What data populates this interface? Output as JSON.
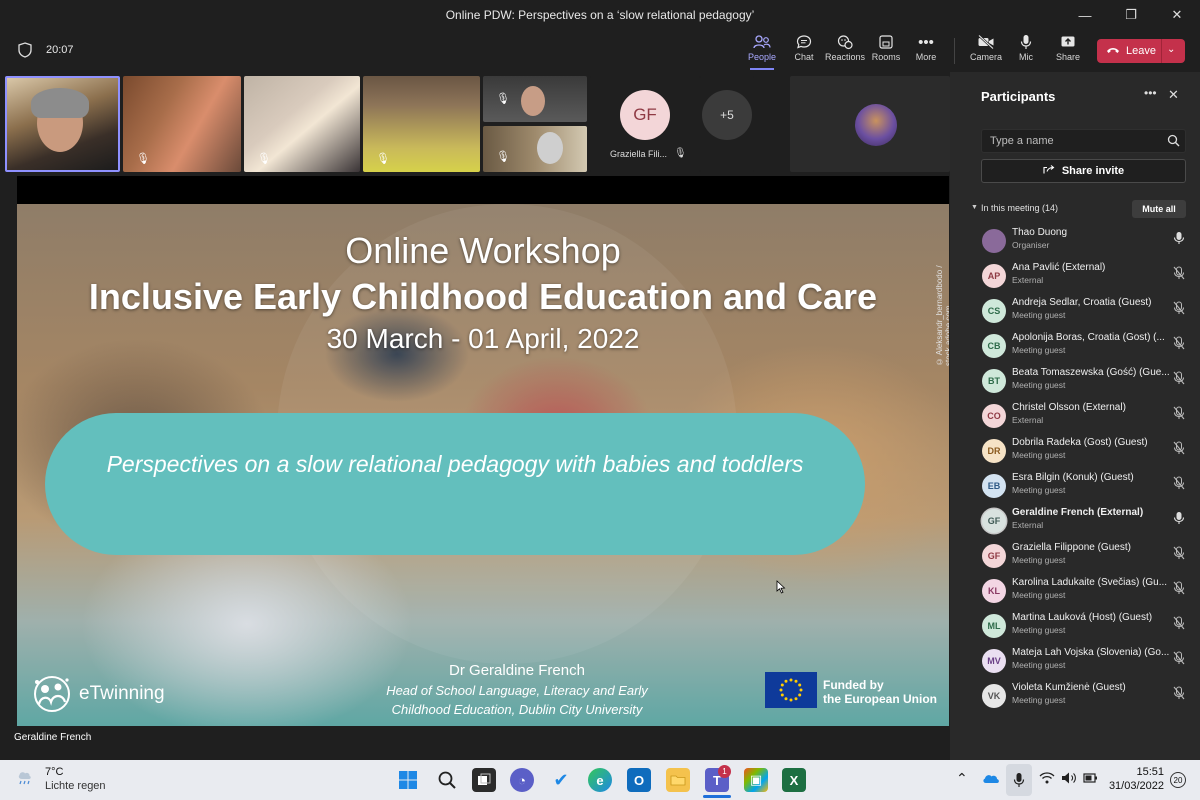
{
  "window": {
    "title": "Online PDW: Perspectives on a ‘slow relational pedagogy’",
    "minimize_icon": "—",
    "restore_icon": "❐",
    "close_icon": "✕"
  },
  "meeting": {
    "timer": "20:07",
    "toolbar": {
      "people": "People",
      "chat": "Chat",
      "reactions": "Reactions",
      "rooms": "Rooms",
      "more": "More",
      "camera": "Camera",
      "mic": "Mic",
      "share": "Share",
      "leave": "Leave"
    }
  },
  "video_strip": {
    "gf_initials": "GF",
    "gf_name": "Graziella Fili...",
    "overflow": "+5"
  },
  "slide": {
    "title_line1": "Online Workshop",
    "title_line2": "Inclusive Early Childhood Education and Care",
    "dates": "30 March - 01 April, 2022",
    "subtitle": "Perspectives on a slow relational pedagogy with babies and toddlers",
    "credit": "© Aleksandr_bernardbodo / stock.adobe.com",
    "speaker": "Dr Geraldine French",
    "role_line1": "Head of School Language, Literacy and Early",
    "role_line2": "Childhood Education, Dublin City University",
    "etwinning": "eTwinning",
    "eu_line1": "Funded by",
    "eu_line2": "the European Union"
  },
  "presenter_label": "Geraldine French",
  "participants": {
    "header": "Participants",
    "search_placeholder": "Type a name",
    "share_invite": "Share invite",
    "in_meeting": "In this meeting (14)",
    "mute_all": "Mute all",
    "list": [
      {
        "initials": "",
        "name": "Thao Duong",
        "role": "Organiser",
        "bg": "#8a6a9a",
        "fg": "#ffffff",
        "mic": "on"
      },
      {
        "initials": "AP",
        "name": "Ana Pavlić (External)",
        "role": "External",
        "bg": "#f3d6d8",
        "fg": "#8f3a44",
        "mic": "off"
      },
      {
        "initials": "CS",
        "name": "Andreja Sedlar, Croatia (Guest)",
        "role": "Meeting guest",
        "bg": "#cfe8da",
        "fg": "#2e6b4a",
        "mic": "off"
      },
      {
        "initials": "CB",
        "name": "Apolonija Boras, Croatia (Gost) (...",
        "role": "Meeting guest",
        "bg": "#cfe8da",
        "fg": "#2e6b4a",
        "mic": "off"
      },
      {
        "initials": "BT",
        "name": "Beata Tomaszewska (Gość) (Gue...",
        "role": "Meeting guest",
        "bg": "#cfe8da",
        "fg": "#2e6b4a",
        "mic": "off"
      },
      {
        "initials": "CO",
        "name": "Christel Olsson (External)",
        "role": "External",
        "bg": "#f3d6d8",
        "fg": "#8f3a44",
        "mic": "off"
      },
      {
        "initials": "DR",
        "name": "Dobrila Radeka (Gost) (Guest)",
        "role": "Meeting guest",
        "bg": "#f6e3c6",
        "fg": "#8a5a1e",
        "mic": "off"
      },
      {
        "initials": "EB",
        "name": "Esra Bilgin (Konuk) (Guest)",
        "role": "Meeting guest",
        "bg": "#d3e3f1",
        "fg": "#2f5a86",
        "mic": "off"
      },
      {
        "initials": "GF",
        "name": "Geraldine French (External)",
        "role": "External",
        "bg": "#d9e2df",
        "fg": "#3f5a55",
        "mic": "on"
      },
      {
        "initials": "GF",
        "name": "Graziella Filippone (Guest)",
        "role": "Meeting guest",
        "bg": "#f3d6d8",
        "fg": "#8f3a44",
        "mic": "off"
      },
      {
        "initials": "KL",
        "name": "Karolina Ladukaite (Svečias) (Gu...",
        "role": "Meeting guest",
        "bg": "#f3d6e4",
        "fg": "#8a3a64",
        "mic": "off"
      },
      {
        "initials": "ML",
        "name": "Martina Lauková (Host) (Guest)",
        "role": "Meeting guest",
        "bg": "#cfe8da",
        "fg": "#2e6b4a",
        "mic": "off"
      },
      {
        "initials": "MV",
        "name": "Mateja Lah Vojska (Slovenia) (Go...",
        "role": "Meeting guest",
        "bg": "#eadff1",
        "fg": "#6a3f86",
        "mic": "off"
      },
      {
        "initials": "VK",
        "name": "Violeta Kumžienė (Guest)",
        "role": "Meeting guest",
        "bg": "#e6e6e6",
        "fg": "#555555",
        "mic": "off"
      }
    ]
  },
  "taskbar": {
    "temperature": "7°C",
    "weather": "Lichte regen",
    "time": "15:51",
    "date": "31/03/2022",
    "teams_badge": "1",
    "notification_count": "20"
  }
}
